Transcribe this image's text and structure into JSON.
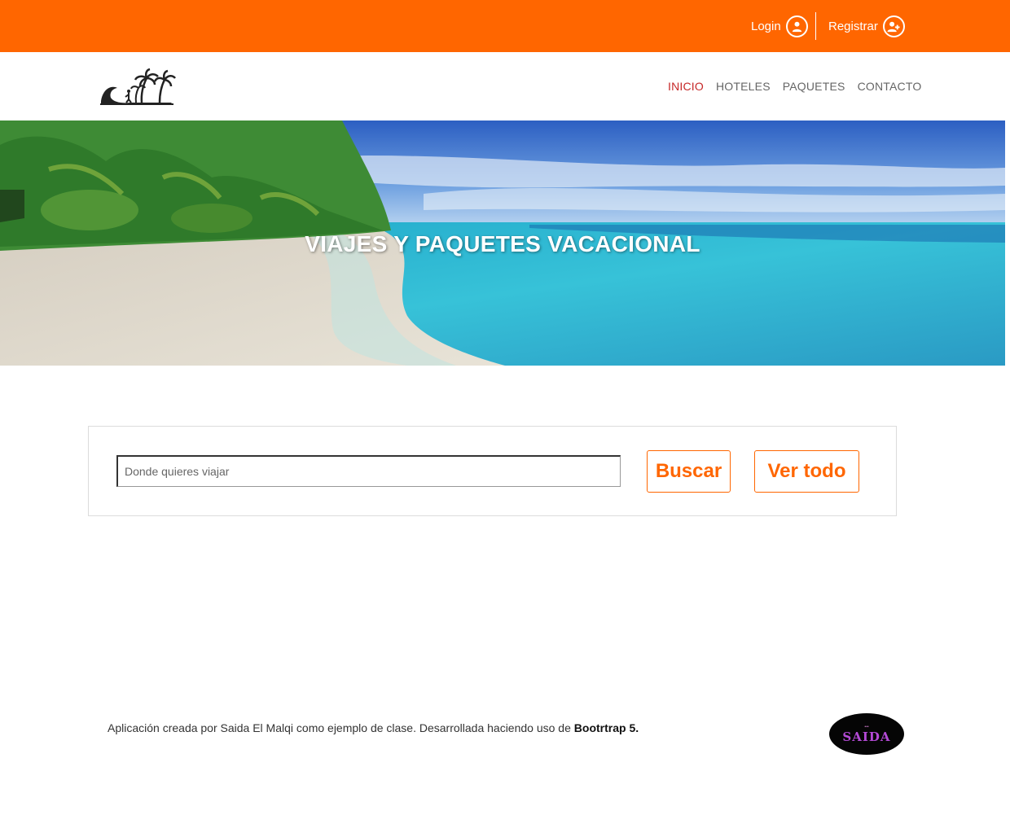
{
  "header": {
    "login_label": "Login",
    "register_label": "Registrar",
    "bg_color": "#ff6600",
    "login_icon": "user-circle-icon",
    "register_icon": "user-add-circle-icon"
  },
  "nav": {
    "logo_icon": "beach-palm-logo",
    "items": [
      {
        "label": "INICIO",
        "active": true
      },
      {
        "label": "HOTELES",
        "active": false
      },
      {
        "label": "PAQUETES",
        "active": false
      },
      {
        "label": "CONTACTO",
        "active": false
      }
    ],
    "active_color": "#c62828"
  },
  "hero": {
    "title": "VIAJES Y PAQUETES VACACIONAL"
  },
  "search": {
    "placeholder": "Donde quieres viajar",
    "value": "",
    "buscar_label": "Buscar",
    "ver_todo_label": "Ver todo",
    "accent_color": "#ff6600"
  },
  "footer": {
    "text_prefix": "Aplicación creada por Saida El Malqi como ejemplo de clase. Desarrollada haciendo uso de ",
    "text_bold": "Bootrtrap 5.",
    "badge_label": "SAIDA"
  }
}
